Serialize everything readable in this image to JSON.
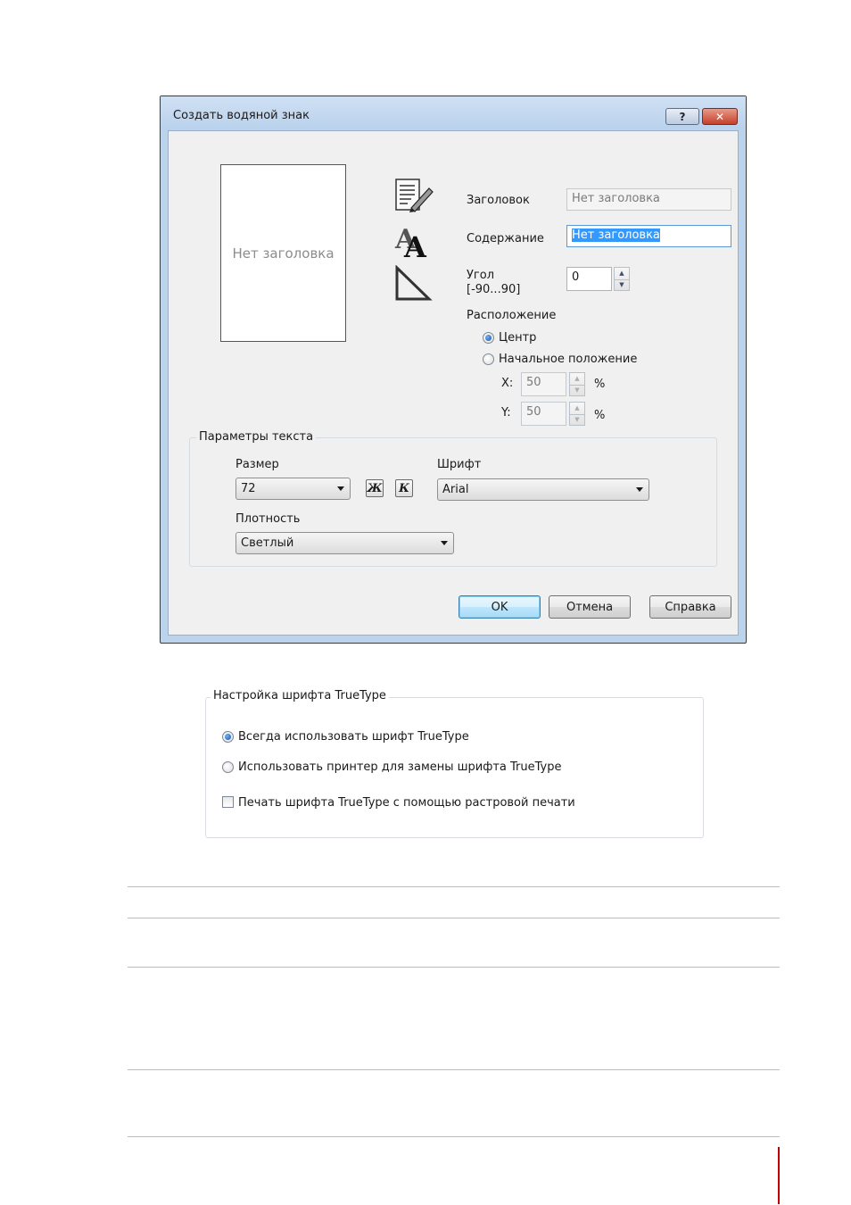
{
  "dialog": {
    "title": "Создать водяной знак",
    "help_glyph": "?",
    "close_glyph": "✕",
    "preview_text": "Нет заголовка",
    "icons": [
      "document-edit-icon",
      "font-aa-icon",
      "triangle-angle-icon"
    ],
    "fields": {
      "title_label": "Заголовок",
      "title_value": "Нет заголовка",
      "content_label": "Содержание",
      "content_value": "Нет заголовка",
      "angle_label_line1": "Угол",
      "angle_label_line2": "[-90...90]",
      "angle_value": "0"
    },
    "position": {
      "label": "Расположение",
      "center_label": "Центр",
      "center_checked": true,
      "start_label": "Начальное положение",
      "start_checked": false,
      "x_label": "X:",
      "x_value": "50",
      "y_label": "Y:",
      "y_value": "50",
      "unit": "%"
    },
    "text_params": {
      "legend": "Параметры текста",
      "size_label": "Размер",
      "size_value": "72",
      "bold_glyph": "Ж",
      "italic_glyph": "К",
      "font_label": "Шрифт",
      "font_value": "Arial",
      "density_label": "Плотность",
      "density_value": "Светлый"
    },
    "buttons": {
      "ok": "OK",
      "cancel": "Отмена",
      "help": "Справка"
    }
  },
  "truetype": {
    "legend": "Настройка шрифта TrueType",
    "always_label": "Всегда использовать шрифт TrueType",
    "always_checked": true,
    "substitute_label": "Использовать принтер для замены шрифта TrueType",
    "substitute_checked": false,
    "raster_label": "Печать шрифта TrueType с помощью растровой печати",
    "raster_checked": false
  },
  "colors": {
    "accent": "#3399ff",
    "page_marker": "#c00000"
  }
}
